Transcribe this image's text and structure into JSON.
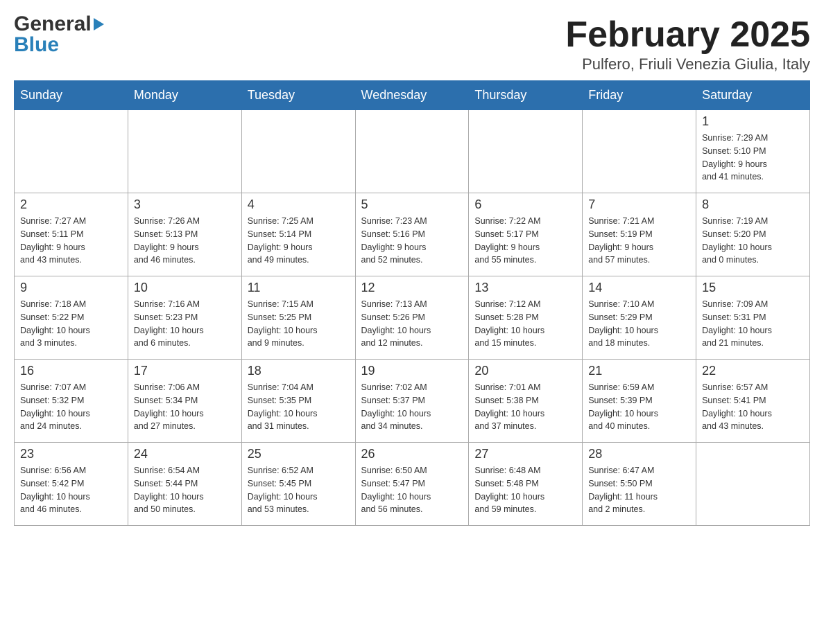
{
  "header": {
    "logo_general": "General",
    "logo_blue": "Blue",
    "month_title": "February 2025",
    "location": "Pulfero, Friuli Venezia Giulia, Italy"
  },
  "weekdays": [
    "Sunday",
    "Monday",
    "Tuesday",
    "Wednesday",
    "Thursday",
    "Friday",
    "Saturday"
  ],
  "weeks": [
    [
      {
        "day": "",
        "info": ""
      },
      {
        "day": "",
        "info": ""
      },
      {
        "day": "",
        "info": ""
      },
      {
        "day": "",
        "info": ""
      },
      {
        "day": "",
        "info": ""
      },
      {
        "day": "",
        "info": ""
      },
      {
        "day": "1",
        "info": "Sunrise: 7:29 AM\nSunset: 5:10 PM\nDaylight: 9 hours\nand 41 minutes."
      }
    ],
    [
      {
        "day": "2",
        "info": "Sunrise: 7:27 AM\nSunset: 5:11 PM\nDaylight: 9 hours\nand 43 minutes."
      },
      {
        "day": "3",
        "info": "Sunrise: 7:26 AM\nSunset: 5:13 PM\nDaylight: 9 hours\nand 46 minutes."
      },
      {
        "day": "4",
        "info": "Sunrise: 7:25 AM\nSunset: 5:14 PM\nDaylight: 9 hours\nand 49 minutes."
      },
      {
        "day": "5",
        "info": "Sunrise: 7:23 AM\nSunset: 5:16 PM\nDaylight: 9 hours\nand 52 minutes."
      },
      {
        "day": "6",
        "info": "Sunrise: 7:22 AM\nSunset: 5:17 PM\nDaylight: 9 hours\nand 55 minutes."
      },
      {
        "day": "7",
        "info": "Sunrise: 7:21 AM\nSunset: 5:19 PM\nDaylight: 9 hours\nand 57 minutes."
      },
      {
        "day": "8",
        "info": "Sunrise: 7:19 AM\nSunset: 5:20 PM\nDaylight: 10 hours\nand 0 minutes."
      }
    ],
    [
      {
        "day": "9",
        "info": "Sunrise: 7:18 AM\nSunset: 5:22 PM\nDaylight: 10 hours\nand 3 minutes."
      },
      {
        "day": "10",
        "info": "Sunrise: 7:16 AM\nSunset: 5:23 PM\nDaylight: 10 hours\nand 6 minutes."
      },
      {
        "day": "11",
        "info": "Sunrise: 7:15 AM\nSunset: 5:25 PM\nDaylight: 10 hours\nand 9 minutes."
      },
      {
        "day": "12",
        "info": "Sunrise: 7:13 AM\nSunset: 5:26 PM\nDaylight: 10 hours\nand 12 minutes."
      },
      {
        "day": "13",
        "info": "Sunrise: 7:12 AM\nSunset: 5:28 PM\nDaylight: 10 hours\nand 15 minutes."
      },
      {
        "day": "14",
        "info": "Sunrise: 7:10 AM\nSunset: 5:29 PM\nDaylight: 10 hours\nand 18 minutes."
      },
      {
        "day": "15",
        "info": "Sunrise: 7:09 AM\nSunset: 5:31 PM\nDaylight: 10 hours\nand 21 minutes."
      }
    ],
    [
      {
        "day": "16",
        "info": "Sunrise: 7:07 AM\nSunset: 5:32 PM\nDaylight: 10 hours\nand 24 minutes."
      },
      {
        "day": "17",
        "info": "Sunrise: 7:06 AM\nSunset: 5:34 PM\nDaylight: 10 hours\nand 27 minutes."
      },
      {
        "day": "18",
        "info": "Sunrise: 7:04 AM\nSunset: 5:35 PM\nDaylight: 10 hours\nand 31 minutes."
      },
      {
        "day": "19",
        "info": "Sunrise: 7:02 AM\nSunset: 5:37 PM\nDaylight: 10 hours\nand 34 minutes."
      },
      {
        "day": "20",
        "info": "Sunrise: 7:01 AM\nSunset: 5:38 PM\nDaylight: 10 hours\nand 37 minutes."
      },
      {
        "day": "21",
        "info": "Sunrise: 6:59 AM\nSunset: 5:39 PM\nDaylight: 10 hours\nand 40 minutes."
      },
      {
        "day": "22",
        "info": "Sunrise: 6:57 AM\nSunset: 5:41 PM\nDaylight: 10 hours\nand 43 minutes."
      }
    ],
    [
      {
        "day": "23",
        "info": "Sunrise: 6:56 AM\nSunset: 5:42 PM\nDaylight: 10 hours\nand 46 minutes."
      },
      {
        "day": "24",
        "info": "Sunrise: 6:54 AM\nSunset: 5:44 PM\nDaylight: 10 hours\nand 50 minutes."
      },
      {
        "day": "25",
        "info": "Sunrise: 6:52 AM\nSunset: 5:45 PM\nDaylight: 10 hours\nand 53 minutes."
      },
      {
        "day": "26",
        "info": "Sunrise: 6:50 AM\nSunset: 5:47 PM\nDaylight: 10 hours\nand 56 minutes."
      },
      {
        "day": "27",
        "info": "Sunrise: 6:48 AM\nSunset: 5:48 PM\nDaylight: 10 hours\nand 59 minutes."
      },
      {
        "day": "28",
        "info": "Sunrise: 6:47 AM\nSunset: 5:50 PM\nDaylight: 11 hours\nand 2 minutes."
      },
      {
        "day": "",
        "info": ""
      }
    ]
  ]
}
